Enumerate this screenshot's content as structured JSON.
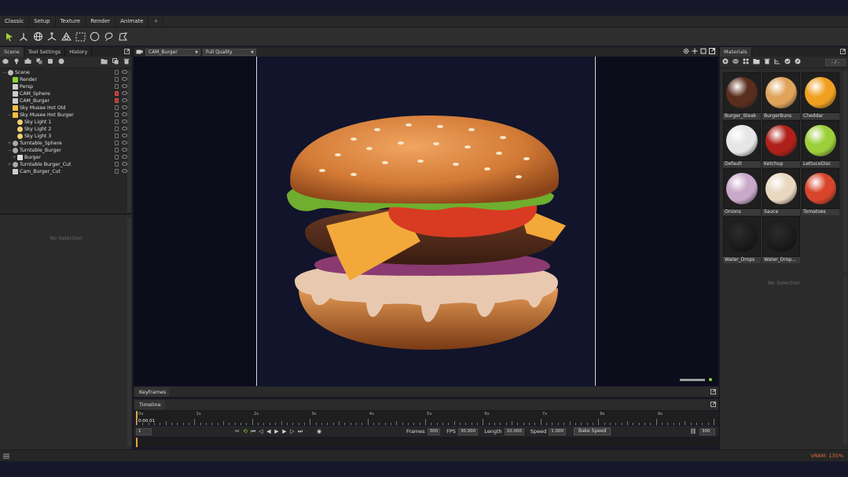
{
  "menu": {
    "tabs": [
      "Classic",
      "Setup",
      "Texture",
      "Render",
      "Animate",
      "+"
    ]
  },
  "left_panel": {
    "tabs": [
      "Scene",
      "Tool Settings",
      "History"
    ],
    "tree": [
      {
        "label": "Scene",
        "depth": 0,
        "twisty": "−",
        "icon": "scene-icon",
        "lock": "normal"
      },
      {
        "label": "Render",
        "depth": 1,
        "twisty": "",
        "icon": "render-icon",
        "lock": "normal"
      },
      {
        "label": "Persp",
        "depth": 1,
        "twisty": "",
        "icon": "camera-icon",
        "lock": "normal"
      },
      {
        "label": "CAM_Sphere",
        "depth": 1,
        "twisty": "",
        "icon": "camera-icon",
        "lock": "red"
      },
      {
        "label": "CAM_Burger",
        "depth": 1,
        "twisty": "",
        "icon": "camera-icon",
        "lock": "red"
      },
      {
        "label": "Sky Musee Hot Old",
        "depth": 1,
        "twisty": "",
        "icon": "sky-icon",
        "lock": "normal"
      },
      {
        "label": "Sky Musee Hot Burger",
        "depth": 1,
        "twisty": "−",
        "icon": "sky-icon",
        "lock": "normal"
      },
      {
        "label": "Sky Light 1",
        "depth": 2,
        "twisty": "",
        "icon": "light-icon",
        "lock": "normal"
      },
      {
        "label": "Sky Light 2",
        "depth": 2,
        "twisty": "",
        "icon": "light-icon",
        "lock": "normal"
      },
      {
        "label": "Sky Light 3",
        "depth": 2,
        "twisty": "",
        "icon": "light-icon",
        "lock": "normal"
      },
      {
        "label": "Turntable_Sphere",
        "depth": 1,
        "twisty": "+",
        "icon": "turntable-icon",
        "lock": "normal"
      },
      {
        "label": "Turntable_Burger",
        "depth": 1,
        "twisty": "−",
        "icon": "turntable-icon",
        "lock": "normal"
      },
      {
        "label": "Burger",
        "depth": 2,
        "twisty": "+",
        "icon": "mesh-icon",
        "lock": "normal"
      },
      {
        "label": "Turntable Burger_Cut",
        "depth": 1,
        "twisty": "+",
        "icon": "turntable-icon",
        "lock": "normal"
      },
      {
        "label": "Cam_Burger_Cut",
        "depth": 1,
        "twisty": "",
        "icon": "camera-icon",
        "lock": "normal"
      }
    ],
    "no_selection": "No Selection"
  },
  "viewport": {
    "camera": "CAM_Burger",
    "quality": "Full Quality"
  },
  "materials": {
    "title": "Materials",
    "counter": "- / -",
    "items": [
      {
        "label": "Burger_Steak",
        "color": "#5a2e1e"
      },
      {
        "label": "BurgerBuns",
        "color": "#e0a35a"
      },
      {
        "label": "Cheddar",
        "color": "#f0a020"
      },
      {
        "label": "Default",
        "color": "#e6e6e6"
      },
      {
        "label": "Ketchup",
        "color": "#b0201a"
      },
      {
        "label": "LettuceDisc",
        "color": "#9ccf3a"
      },
      {
        "label": "Onions",
        "color": "#c9a9c9"
      },
      {
        "label": "Sauce",
        "color": "#e8d8c0"
      },
      {
        "label": "Tomatoes",
        "color": "#d8452a"
      },
      {
        "label": "Water_Drops",
        "color": "#202020"
      },
      {
        "label": "Water_Drop...",
        "color": "#202020"
      }
    ],
    "no_selection": "No Selection"
  },
  "keyframes": {
    "tab": "Keyframes"
  },
  "timeline": {
    "tab": "Timeline",
    "current_time": "0:00.01",
    "ticks": [
      "0s",
      "1s",
      "2s",
      "3s",
      "4s",
      "5s",
      "6s",
      "7s",
      "8s",
      "9s"
    ],
    "start_field": "1",
    "frames_label": "Frames",
    "frames": "300",
    "fps_label": "FPS",
    "fps": "30.000",
    "length_label": "Length",
    "length": "10.000",
    "speed_label": "Speed",
    "speed": "1.000",
    "bake_label": "Bake Speed",
    "end_frame": "300"
  },
  "status": {
    "vram": "VRAM: 135%"
  },
  "colors": {
    "accent": "#e8a33d",
    "vram": "#e8703a",
    "ok": "#8bd13a"
  }
}
